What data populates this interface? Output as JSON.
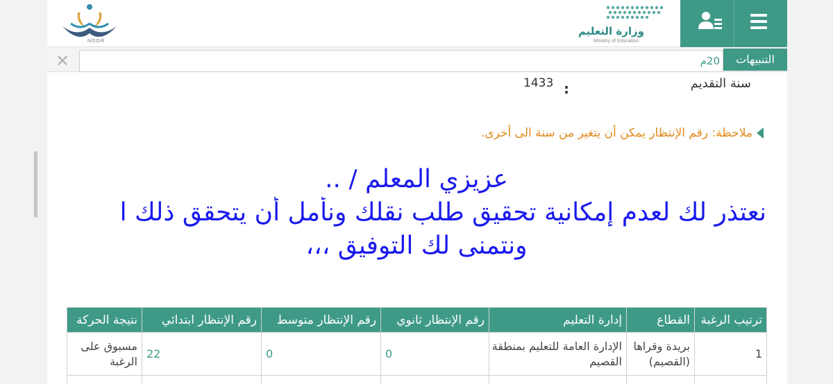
{
  "header": {
    "ministry_name": "وزارة التعليم",
    "ministry_subtitle": "Ministry of Education",
    "noor_label": "NOOR"
  },
  "notifications": {
    "label": "التنبيهات",
    "value": "20م"
  },
  "application": {
    "year_label": "سنة التقديم",
    "year_colon": ":",
    "year_value": "1433"
  },
  "note": "ملاحظة: رقم الإنتظار يمكن أن يتغير من سنة الى أخرى.",
  "message": {
    "line1": "عزيزي المعلم / ..",
    "line2": "نعتذر لك لعدم إمكانية تحقيق طلب نقلك ونأمل أن يتحقق ذلك ا",
    "line3": "ونتمنى لك التوفيق ،،،"
  },
  "table": {
    "headers": [
      "ترتيب الرغبة",
      "القطاع",
      "إدارة التعليم",
      "رقم الإنتظار ثانوي",
      "رقم الإنتظار متوسط",
      "رقم الإنتظار ابتدائي",
      "نتيجة الحركة"
    ],
    "rows": [
      {
        "rank": "1",
        "sector": "بريدة وقراها (القصيم)",
        "admin": "الإدارة العامة للتعليم بمنطقة القصيم",
        "secondary": "0",
        "intermediate": "0",
        "primary": "22",
        "result": "مسبوق على الرغبة"
      }
    ]
  },
  "colors": {
    "accent": "#3e9a86",
    "message": "#1a1aee",
    "note": "#e08a1e"
  },
  "icons": [
    "hamburger-menu-icon",
    "user-list-icon",
    "close-icon",
    "note-arrow-icon"
  ]
}
